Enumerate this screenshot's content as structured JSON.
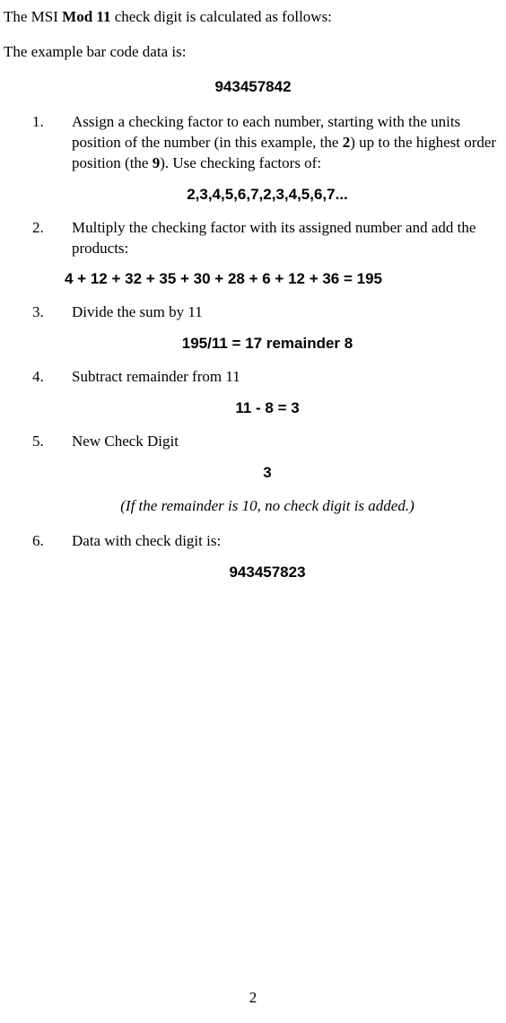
{
  "intro": {
    "prefix": "The MSI ",
    "bold": "Mod 11",
    "suffix": " check digit is calculated as follows:"
  },
  "exampleLine": "The example bar code data is:",
  "exampleData": "943457842",
  "steps": [
    {
      "num": "1.",
      "parts": [
        {
          "text": "Assign a checking factor to each number, starting with the units position of the number (in this example, the ",
          "bold": false
        },
        {
          "text": "2",
          "bold": true
        },
        {
          "text": ") up to the highest order position (the ",
          "bold": false
        },
        {
          "text": "9",
          "bold": true
        },
        {
          "text": ").  Use checking factors of:",
          "bold": false
        }
      ]
    },
    {
      "num": "2.",
      "text": "Multiply the checking factor with its assigned number and add the products:"
    },
    {
      "num": "3.",
      "text": "Divide the sum by 11"
    },
    {
      "num": "4.",
      "text": "Subtract remainder from 11"
    },
    {
      "num": "5.",
      "text": "New Check Digit"
    },
    {
      "num": "6.",
      "text": "Data with check digit is:"
    }
  ],
  "calcs": {
    "factors": "2,3,4,5,6,7,2,3,4,5,6,7...",
    "sum": "4 + 12 + 32 + 35 + 30 + 28 + 6 + 12 + 36 = 195",
    "division": "195/11 = 17 remainder 8",
    "subtract": "11 - 8 = 3",
    "newDigit": "3",
    "note": "(If the remainder is 10, no check digit is added.)",
    "final": "943457823"
  },
  "pageNumber": "2"
}
